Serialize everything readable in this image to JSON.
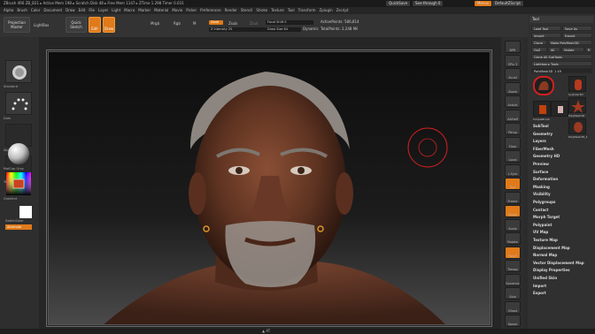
{
  "titlebar": {
    "text": "ZBrush 4R6   ZB_B21  ▸ Active Mem 198 ▸ Scratch Disk 48 ▸ Free Mem 1147 ▸ ZTime 1.298  Timer 0.031",
    "quicksave": "QuickSave",
    "seethrough": "See-through  0",
    "menus": "Menus",
    "defaultzscript": "DefaultZScript"
  },
  "menubar": [
    "Alpha",
    "Brush",
    "Color",
    "Document",
    "Draw",
    "Edit",
    "File",
    "Layer",
    "Light",
    "Macro",
    "Marker",
    "Material",
    "Movie",
    "Picker",
    "Preferences",
    "Render",
    "Stencil",
    "Stroke",
    "Texture",
    "Tool",
    "Transform",
    "Zplugin",
    "Zscript"
  ],
  "shelf": {
    "projection_master": "Projection Master",
    "lightbox": "LightBox",
    "quick_sketch": "Quick Sketch",
    "edit": "Edit",
    "draw": "Draw",
    "mrgb": "Mrgb",
    "rgb": "Rgb",
    "m": "M",
    "zadd": "Zadd",
    "zsub": "Zsub",
    "zcut": "Zcut",
    "z_intensity": "Z Intensity 25",
    "focal_shift": "Focal Shift 0",
    "draw_size": "Draw Size 64",
    "dynamic": "Dynamic",
    "active_points": "ActivePoints: 586,814",
    "total_points": "TotalPoints: 2.248 Mil"
  },
  "lefttray": {
    "brush_label": "Standard",
    "stroke_label": "Dots",
    "alpha_label": "Alpha Off",
    "texture_label": "Texture Off",
    "material_label": "MatCap Gray",
    "gradient_label": "Gradient",
    "switch_label": "SwitchColor",
    "alternate_label": "Alternate"
  },
  "iconstrip": [
    "BPR",
    "SPix 3",
    "Scroll",
    "Zoom",
    "Actual",
    "AAHalf",
    "Persp",
    "Floor",
    "Local",
    "L.Sym",
    "Xyz",
    "Frame",
    "Move",
    "Scale",
    "Rotate",
    "PolyF",
    "Transp",
    "Dynamic",
    "Solo",
    "Ghost",
    "Xpose"
  ],
  "rightpanel": {
    "tool_header": "Tool",
    "load_tool": "Load Tool",
    "save_as": "Save As",
    "import": "Import",
    "export": "Export",
    "clone": "Clone",
    "make_polymesh": "Make PolyMesh3D",
    "goz": "GoZ",
    "all": "All",
    "visible": "Visible",
    "r": "R",
    "clone_all_subtools": "Clone All SubTools",
    "lightbox_tools": "Lightbox ▸ Tools",
    "current_tool": "PolyMesh3D_1  49",
    "tools": [
      "PolyMesh3D_1",
      "Cylinder3D",
      "PolyMesh3D",
      "SimpleBrush",
      "Eraser",
      "PolyMesh3D_1"
    ],
    "sections": [
      "SubTool",
      "Geometry",
      "Layers",
      "FiberMesh",
      "Geometry HD",
      "Preview",
      "Surface",
      "Deformation",
      "Masking",
      "Visibility",
      "Polygroups",
      "Contact",
      "Morph Target",
      "Polypaint",
      "UV Map",
      "Texture Map",
      "Displacement Map",
      "Normal Map",
      "Vector Displacement Map",
      "Display Properties",
      "Unified Skin",
      "Import",
      "Export"
    ]
  },
  "bottombar": "▲ AT",
  "colors": {
    "accent": "#e07a1a",
    "panel": "#303030",
    "canvas_top": "#0d0d0d",
    "skin": "#6b3a26",
    "brush_ring": "#d02020"
  }
}
